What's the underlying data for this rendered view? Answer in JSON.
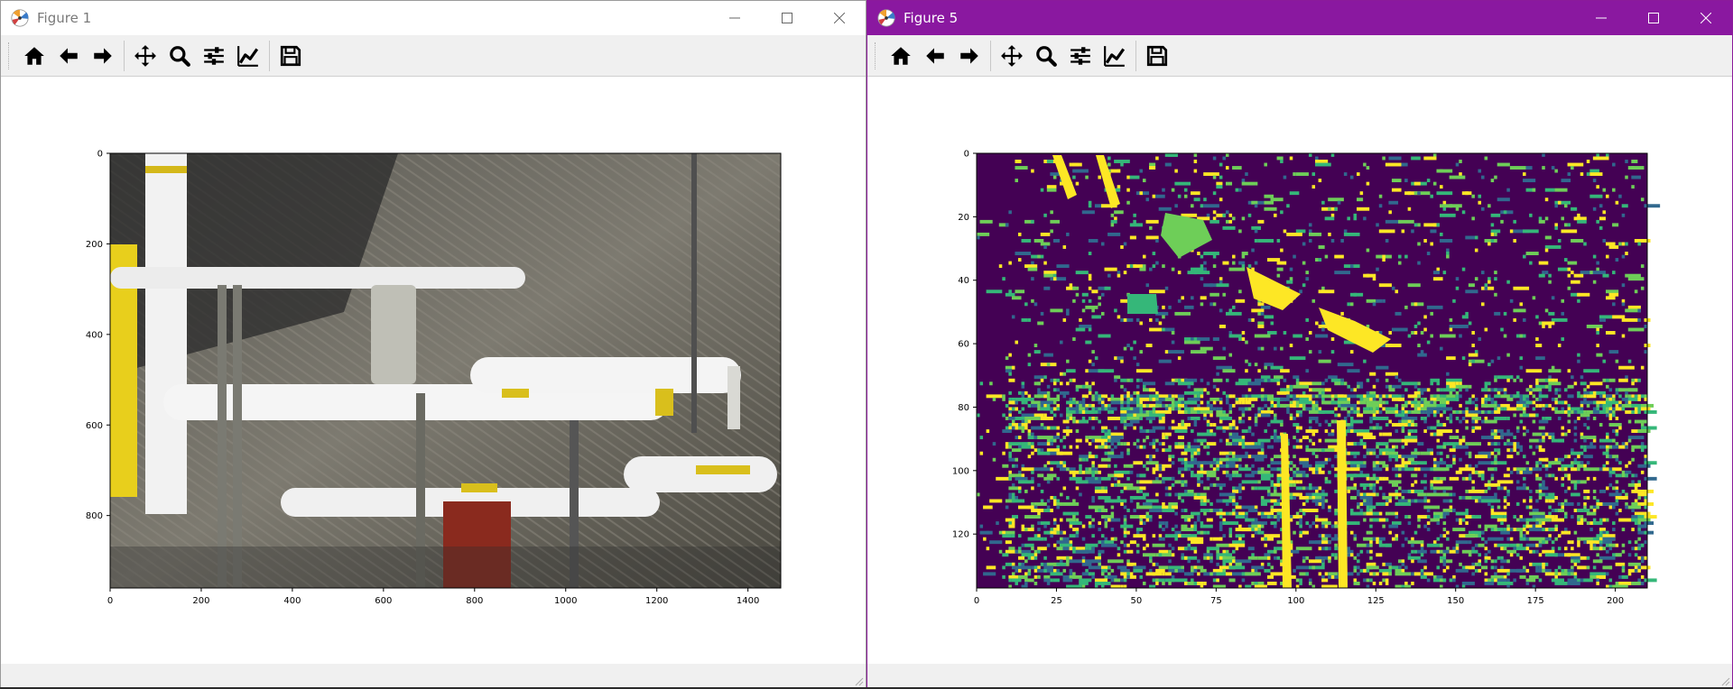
{
  "windows": [
    {
      "title": "Figure 1",
      "state": "inactive",
      "plot": {
        "content": "photograph",
        "x_ticks": [
          "0",
          "200",
          "400",
          "600",
          "800",
          "1000",
          "1200",
          "1400"
        ],
        "y_ticks": [
          "0",
          "200",
          "400",
          "600",
          "800"
        ]
      }
    },
    {
      "title": "Figure 5",
      "state": "active",
      "accent": "#8a18a0",
      "plot": {
        "content": "label-map",
        "colormap": [
          "#440154",
          "#31688e",
          "#35b779",
          "#6ece58",
          "#fde725"
        ],
        "x_ticks": [
          "0",
          "25",
          "50",
          "75",
          "100",
          "125",
          "150",
          "175",
          "200"
        ],
        "y_ticks": [
          "0",
          "20",
          "40",
          "60",
          "80",
          "100",
          "120"
        ]
      }
    }
  ],
  "toolbar": [
    {
      "name": "home-icon",
      "label": "Home"
    },
    {
      "name": "back-icon",
      "label": "Back"
    },
    {
      "name": "forward-icon",
      "label": "Forward"
    },
    {
      "name": "pan-icon",
      "label": "Pan"
    },
    {
      "name": "zoom-icon",
      "label": "Zoom"
    },
    {
      "name": "subplots-icon",
      "label": "Subplots"
    },
    {
      "name": "customize-icon",
      "label": "Customize"
    },
    {
      "name": "save-icon",
      "label": "Save"
    }
  ],
  "window_controls": [
    "minimize-icon",
    "maximize-icon",
    "close-icon"
  ]
}
